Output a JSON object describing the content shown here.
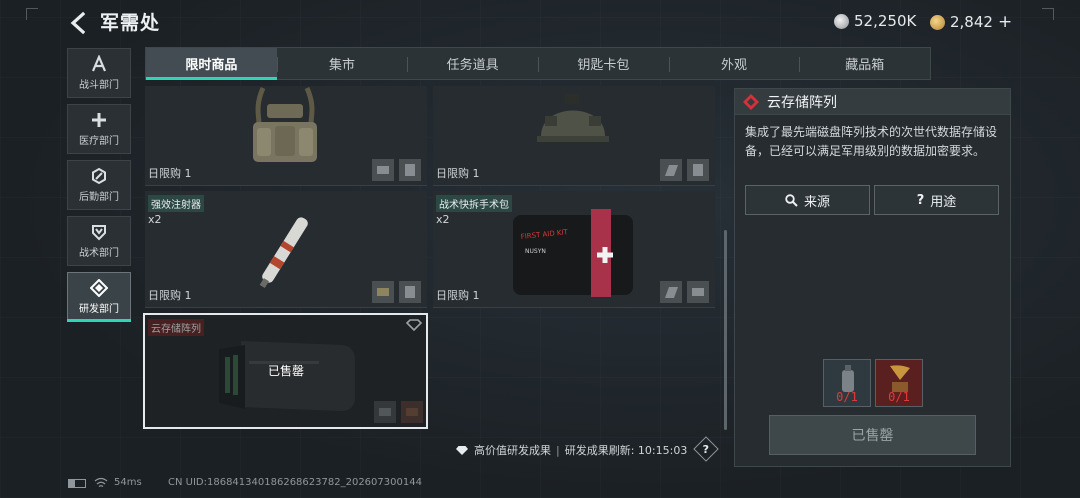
{
  "header": {
    "title": "军需处",
    "currency_silver": "52,250K",
    "currency_gold": "2,842",
    "add_symbol": "+"
  },
  "sidebar": {
    "items": [
      {
        "label": "战斗部门",
        "icon": "combat-icon"
      },
      {
        "label": "医疗部门",
        "icon": "medical-cross-icon"
      },
      {
        "label": "后勤部门",
        "icon": "logistics-icon"
      },
      {
        "label": "战术部门",
        "icon": "tactical-shield-icon"
      },
      {
        "label": "研发部门",
        "icon": "research-icon",
        "active": true
      }
    ]
  },
  "tabs": [
    "限时商品",
    "集市",
    "任务道具",
    "钥匙卡包",
    "外观",
    "藏品箱"
  ],
  "active_tab": "限时商品",
  "items": [
    {
      "name": "",
      "qty": "",
      "limit": "日限购 1"
    },
    {
      "name": "",
      "qty": "",
      "limit": "日限购 1"
    },
    {
      "name": "强效注射器",
      "qty": "x2",
      "limit": "日限购 1"
    },
    {
      "name": "战术快拆手术包",
      "qty": "x2",
      "limit": "日限购 1",
      "kit_text": "FIRST AID KIT",
      "kit_brand": "NUSYN"
    },
    {
      "name": "云存储阵列",
      "qty": "",
      "status": "已售罄"
    }
  ],
  "detail": {
    "title": "云存储阵列",
    "description": "集成了最先端磁盘阵列技术的次世代数据存储设备，已经可以满足军用级别的数据加密要求。",
    "source_button": "来源",
    "usage_button": "用途",
    "requirements": [
      {
        "count": "0/1",
        "icon": "grenade-icon"
      },
      {
        "count": "0/1",
        "icon": "gramophone-icon"
      }
    ],
    "sold_out_button": "已售罄"
  },
  "footer": {
    "high_value_label": "高价值研发成果",
    "separator": "|",
    "refresh_label": "研发成果刷新: 10:15:03",
    "help": "?"
  },
  "status_bar": {
    "ping": "54ms",
    "uid": "CN UID:18684134018626862378​2_202607300144"
  },
  "colors": {
    "accent": "#2fd6b4",
    "danger": "#e23a3a",
    "panel": "#262c2f"
  }
}
